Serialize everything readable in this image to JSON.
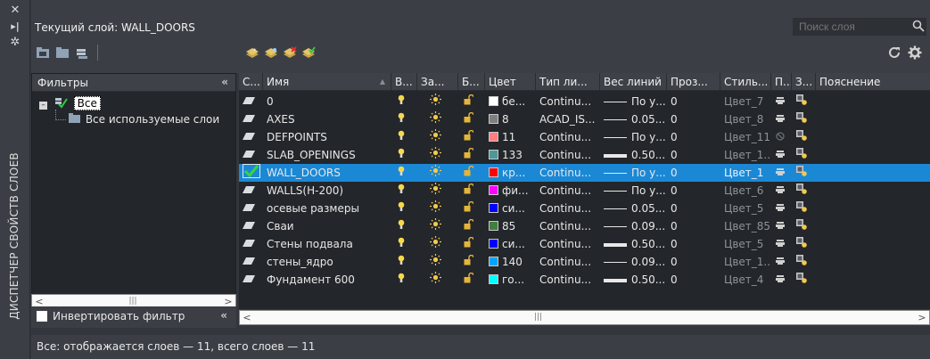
{
  "palette_title": "ДИСПЕТЧЕР СВОЙСТВ СЛОЕВ",
  "current_layer_text": "Текущий слой: WALL_DOORS",
  "search": {
    "placeholder": "Поиск слоя"
  },
  "filters": {
    "header": "Фильтры",
    "collapse": "«",
    "tree": [
      {
        "label": "Все",
        "selected": true
      },
      {
        "label": "Все используемые слои"
      }
    ],
    "invert_label": "Инвертировать фильтр",
    "invert_checked": false
  },
  "columns": [
    "С...",
    "Имя",
    "В...",
    "За...",
    "Б...",
    "Цвет",
    "Тип ли...",
    "Вес линий",
    "Проз...",
    "Стиль...",
    "П...",
    "З...",
    "Пояснение"
  ],
  "layers": [
    {
      "name": "0",
      "color_hex": "#ffffff",
      "color_label": "бе...",
      "linetype": "Continu...",
      "weight": "По у...",
      "transparency": "0",
      "plot_style": "Цвет_7",
      "current": false,
      "thick": false
    },
    {
      "name": "AXES",
      "color_hex": "#7f7f7f",
      "color_label": "8",
      "linetype": "ACAD_IS...",
      "weight": "0.05...",
      "transparency": "0",
      "plot_style": "Цвет_8",
      "current": false,
      "thick": false
    },
    {
      "name": "DEFPOINTS",
      "color_hex": "#ff7f7f",
      "color_label": "11",
      "linetype": "Continu...",
      "weight": "По у...",
      "transparency": "0",
      "plot_style": "Цвет_11",
      "current": false,
      "thick": false
    },
    {
      "name": "SLAB_OPENINGS",
      "color_hex": "#4c9999",
      "color_label": "133",
      "linetype": "Continu...",
      "weight": "0.50...",
      "transparency": "0",
      "plot_style": "Цвет_1...",
      "current": false,
      "thick": true
    },
    {
      "name": "WALL_DOORS",
      "color_hex": "#ff0000",
      "color_label": "кр...",
      "linetype": "Continu...",
      "weight": "По у...",
      "transparency": "0",
      "plot_style": "Цвет_1",
      "current": true,
      "thick": false
    },
    {
      "name": "WALLS(H-200)",
      "color_hex": "#ff00ff",
      "color_label": "фи...",
      "linetype": "Continu...",
      "weight": "По у...",
      "transparency": "0",
      "plot_style": "Цвет_6",
      "current": false,
      "thick": false
    },
    {
      "name": "осевые размеры",
      "color_hex": "#0000ff",
      "color_label": "си...",
      "linetype": "Continu...",
      "weight": "0.05...",
      "transparency": "0",
      "plot_style": "Цвет_5",
      "current": false,
      "thick": false
    },
    {
      "name": "Сваи",
      "color_hex": "#3f7f3f",
      "color_label": "85",
      "linetype": "Continu...",
      "weight": "0.09...",
      "transparency": "0",
      "plot_style": "Цвет_85",
      "current": false,
      "thick": false
    },
    {
      "name": "Стены подвала",
      "color_hex": "#0000ff",
      "color_label": "си...",
      "linetype": "Continu...",
      "weight": "0.50...",
      "transparency": "0",
      "plot_style": "Цвет_5",
      "current": false,
      "thick": true
    },
    {
      "name": "стены_ядро",
      "color_hex": "#00a5ff",
      "color_label": "140",
      "linetype": "Continu...",
      "weight": "0.09...",
      "transparency": "0",
      "plot_style": "Цвет_1...",
      "current": false,
      "thick": false
    },
    {
      "name": "Фундамент 600",
      "color_hex": "#00ffff",
      "color_label": "го...",
      "linetype": "Continu...",
      "weight": "0.50...",
      "transparency": "0",
      "plot_style": "Цвет_4",
      "current": false,
      "thick": true
    }
  ],
  "status": "Все: отображается слоев — 11, всего слоев — 11",
  "colors": {
    "selection": "#1b88d6",
    "panel": "#23262a",
    "chrome": "#3b3f45",
    "bulb": "#f5d94a",
    "sun": "#f2c94c",
    "lock": "#e5b53a"
  }
}
